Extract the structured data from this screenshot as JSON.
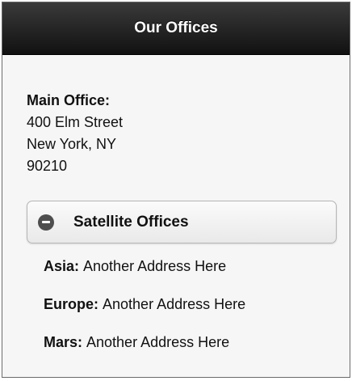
{
  "header": {
    "title": "Our Offices"
  },
  "main_office": {
    "label": "Main Office:",
    "street": "400 Elm Street",
    "city": "New York, NY",
    "zip": "90210"
  },
  "satellite": {
    "title": "Satellite Offices",
    "icon": "minus-circle-icon",
    "offices": [
      {
        "region": "Asia:",
        "address": "Another Address Here"
      },
      {
        "region": "Europe:",
        "address": "Another Address Here"
      },
      {
        "region": "Mars:",
        "address": "Another Address Here"
      }
    ]
  }
}
